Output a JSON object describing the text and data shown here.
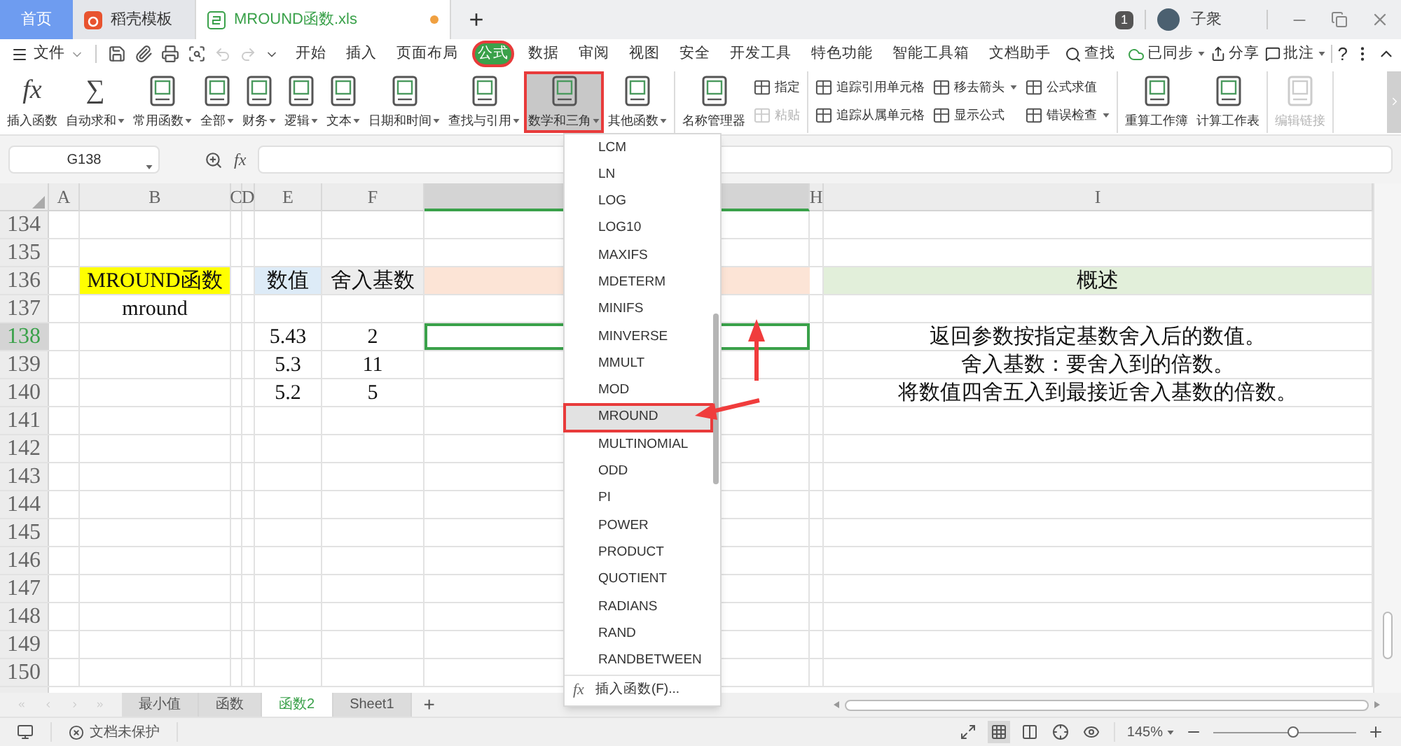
{
  "title_bar": {
    "tabs": [
      {
        "label": "首页",
        "kind": "home",
        "selected": false
      },
      {
        "label": "稻壳模板",
        "kind": "template",
        "selected": false
      },
      {
        "label": "MROUND函数.xls",
        "kind": "sheet",
        "selected": true,
        "modified": true
      }
    ],
    "new_tab": "+",
    "badge": "1",
    "user": "子衆"
  },
  "menu_bar": {
    "file": "文件",
    "tabs": [
      {
        "label": "开始",
        "selected": false,
        "highlighted": false
      },
      {
        "label": "插入",
        "selected": false,
        "highlighted": false
      },
      {
        "label": "页面布局",
        "selected": false,
        "highlighted": false
      },
      {
        "label": "公式",
        "selected": true,
        "highlighted": true
      },
      {
        "label": "数据",
        "selected": false,
        "highlighted": false
      },
      {
        "label": "审阅",
        "selected": false,
        "highlighted": false
      },
      {
        "label": "视图",
        "selected": false,
        "highlighted": false
      },
      {
        "label": "安全",
        "selected": false,
        "highlighted": false
      },
      {
        "label": "开发工具",
        "selected": false,
        "highlighted": false
      },
      {
        "label": "特色功能",
        "selected": false,
        "highlighted": false
      },
      {
        "label": "智能工具箱",
        "selected": false,
        "highlighted": false
      },
      {
        "label": "文档助手",
        "selected": false,
        "highlighted": false
      }
    ],
    "search": "查找",
    "sync": "已同步",
    "share": "分享",
    "comment": "批注",
    "help": "?"
  },
  "ribbon": {
    "groups": [
      {
        "items": [
          {
            "kind": "glyph",
            "glyph": "fx",
            "label": "插入函数",
            "caret": false,
            "selected": false,
            "highlighted": false,
            "disabled": false
          },
          {
            "kind": "glyph",
            "glyph": "∑",
            "label": "自动求和",
            "caret": true,
            "selected": false,
            "highlighted": false,
            "disabled": false
          },
          {
            "kind": "book",
            "label": "常用函数",
            "caret": true,
            "selected": false,
            "highlighted": false,
            "disabled": false
          },
          {
            "kind": "book",
            "label": "全部",
            "caret": true,
            "selected": false,
            "highlighted": false,
            "disabled": false
          },
          {
            "kind": "book",
            "label": "财务",
            "caret": true,
            "selected": false,
            "highlighted": false,
            "disabled": false
          },
          {
            "kind": "book",
            "label": "逻辑",
            "caret": true,
            "selected": false,
            "highlighted": false,
            "disabled": false
          },
          {
            "kind": "book",
            "label": "文本",
            "caret": true,
            "selected": false,
            "highlighted": false,
            "disabled": false
          },
          {
            "kind": "book",
            "label": "日期和时间",
            "caret": true,
            "selected": false,
            "highlighted": false,
            "disabled": false
          },
          {
            "kind": "book",
            "label": "查找与引用",
            "caret": true,
            "selected": false,
            "highlighted": false,
            "disabled": false
          },
          {
            "kind": "book",
            "label": "数学和三角",
            "caret": true,
            "selected": true,
            "highlighted": true,
            "disabled": false
          },
          {
            "kind": "book",
            "label": "其他函数",
            "caret": true,
            "selected": false,
            "highlighted": false,
            "disabled": false
          }
        ]
      },
      {
        "items": [
          {
            "kind": "book",
            "label": "名称管理器",
            "caret": false,
            "selected": false,
            "highlighted": false,
            "disabled": false
          },
          {
            "kind": "small",
            "label": "指定",
            "caret": false,
            "disabled": false
          },
          {
            "kind": "small",
            "label": "粘贴",
            "caret": false,
            "disabled": true
          }
        ]
      },
      {
        "items": [
          {
            "kind": "small",
            "label": "追踪引用单元格",
            "caret": false,
            "disabled": false
          },
          {
            "kind": "small",
            "label": "追踪从属单元格",
            "caret": false,
            "disabled": false
          },
          {
            "kind": "small",
            "label": "移去箭头",
            "caret": true,
            "disabled": false
          },
          {
            "kind": "small",
            "label": "显示公式",
            "caret": false,
            "disabled": false
          },
          {
            "kind": "small",
            "label": "公式求值",
            "caret": false,
            "disabled": false
          },
          {
            "kind": "small",
            "label": "错误检查",
            "caret": true,
            "disabled": false
          }
        ]
      },
      {
        "items": [
          {
            "kind": "book",
            "label": "重算工作簿",
            "caret": false,
            "selected": false,
            "highlighted": false,
            "disabled": false
          },
          {
            "kind": "book",
            "label": "计算工作表",
            "caret": false,
            "selected": false,
            "highlighted": false,
            "disabled": false
          }
        ]
      },
      {
        "items": [
          {
            "kind": "book",
            "label": "编辑链接",
            "caret": false,
            "selected": false,
            "highlighted": false,
            "disabled": true
          }
        ]
      }
    ]
  },
  "formula_bar": {
    "cell_ref": "G138",
    "fx": "fx"
  },
  "sheet": {
    "columns": [
      {
        "label": "A",
        "selected": false
      },
      {
        "label": "B",
        "selected": false
      },
      {
        "label": "C",
        "selected": false
      },
      {
        "label": "D",
        "selected": false
      },
      {
        "label": "E",
        "selected": false
      },
      {
        "label": "F",
        "selected": false
      },
      {
        "selected": true
      },
      {
        "label": "H",
        "selected": false
      },
      {
        "label": "I",
        "selected": false
      }
    ],
    "rows": [
      {
        "number": "134",
        "selected": false
      },
      {
        "number": "135",
        "selected": false
      },
      {
        "number": "136",
        "selected": false,
        "cells": [
          {},
          {
            "text": "MROUND函数",
            "color": "#ffff00"
          },
          {},
          {},
          {
            "text": "数值",
            "color": "#ddebf7"
          },
          {
            "text": "舍入基数",
            "color": "#ededed"
          },
          {
            "color": "#fce4d6"
          },
          {},
          {
            "text": "概述",
            "color": "#e2efda"
          }
        ]
      },
      {
        "number": "137",
        "selected": false,
        "cells": [
          {},
          {
            "text": "mround"
          }
        ]
      },
      {
        "number": "138",
        "selected": true,
        "cells": [
          {},
          {},
          {},
          {},
          {
            "text": "5.43"
          },
          {
            "text": "2"
          },
          {
            "active": true
          },
          {},
          {
            "text": "返回参数按指定基数舍入后的数值。"
          }
        ]
      },
      {
        "number": "139",
        "selected": false,
        "cells": [
          {},
          {},
          {},
          {},
          {
            "text": "5.3"
          },
          {
            "text": "11"
          },
          {},
          {},
          {
            "text": "舍入基数：要舍入到的倍数。"
          }
        ]
      },
      {
        "number": "140",
        "selected": false,
        "cells": [
          {},
          {},
          {},
          {},
          {
            "text": "5.2"
          },
          {
            "text": "5"
          },
          {},
          {},
          {
            "text": "将数值四舍五入到最接近舍入基数的倍数。"
          }
        ]
      },
      {
        "number": "141",
        "selected": false
      },
      {
        "number": "142",
        "selected": false
      },
      {
        "number": "143",
        "selected": false
      },
      {
        "number": "144",
        "selected": false
      },
      {
        "number": "145",
        "selected": false
      },
      {
        "number": "146",
        "selected": false
      },
      {
        "number": "147",
        "selected": false
      },
      {
        "number": "148",
        "selected": false
      },
      {
        "number": "149",
        "selected": false
      },
      {
        "number": "150",
        "selected": false
      }
    ]
  },
  "dropdown": {
    "items": [
      {
        "label": "LCM",
        "selected": false,
        "highlighted": false
      },
      {
        "label": "LN",
        "selected": false,
        "highlighted": false
      },
      {
        "label": "LOG",
        "selected": false,
        "highlighted": false
      },
      {
        "label": "LOG10",
        "selected": false,
        "highlighted": false
      },
      {
        "label": "MAXIFS",
        "selected": false,
        "highlighted": false
      },
      {
        "label": "MDETERM",
        "selected": false,
        "highlighted": false
      },
      {
        "label": "MINIFS",
        "selected": false,
        "highlighted": false
      },
      {
        "label": "MINVERSE",
        "selected": false,
        "highlighted": false
      },
      {
        "label": "MMULT",
        "selected": false,
        "highlighted": false
      },
      {
        "label": "MOD",
        "selected": false,
        "highlighted": false
      },
      {
        "label": "MROUND",
        "selected": true,
        "highlighted": true
      },
      {
        "label": "MULTINOMIAL",
        "selected": false,
        "highlighted": false
      },
      {
        "label": "ODD",
        "selected": false,
        "highlighted": false
      },
      {
        "label": "PI",
        "selected": false,
        "highlighted": false
      },
      {
        "label": "POWER",
        "selected": false,
        "highlighted": false
      },
      {
        "label": "PRODUCT",
        "selected": false,
        "highlighted": false
      },
      {
        "label": "QUOTIENT",
        "selected": false,
        "highlighted": false
      },
      {
        "label": "RADIANS",
        "selected": false,
        "highlighted": false
      },
      {
        "label": "RAND",
        "selected": false,
        "highlighted": false
      },
      {
        "label": "RANDBETWEEN",
        "selected": false,
        "highlighted": false
      }
    ],
    "footer_glyph": "fx",
    "footer": "插入函数(F)..."
  },
  "sheet_tabs": {
    "tabs": [
      {
        "label": "最小值",
        "selected": false
      },
      {
        "label": "函数",
        "selected": false
      },
      {
        "label": "函数2",
        "selected": true
      },
      {
        "label": "Sheet1",
        "selected": false
      }
    ],
    "add": "+"
  },
  "status_bar": {
    "protection": "文档未保护",
    "views": [
      {
        "selected": false
      },
      {
        "selected": true
      },
      {
        "selected": false
      },
      {
        "selected": false
      },
      {
        "selected": false
      }
    ],
    "zoom": "145%",
    "zoom_slider": {
      "level": 0.56
    }
  }
}
